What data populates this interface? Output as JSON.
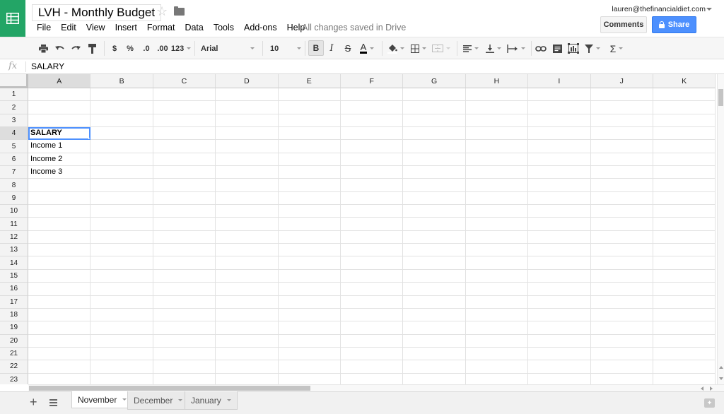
{
  "header": {
    "doc_title": "LVH - Monthly Budget",
    "menu": [
      "File",
      "Edit",
      "View",
      "Insert",
      "Format",
      "Data",
      "Tools",
      "Add-ons",
      "Help"
    ],
    "save_status": "All changes saved in Drive",
    "user_email": "lauren@thefinancialdiet.com",
    "comments_label": "Comments",
    "share_label": "Share",
    "brand_color": "#23a566",
    "share_color": "#4d90fe"
  },
  "toolbar": {
    "currency": "$",
    "percent": "%",
    "decrease_decimal": ".0",
    "increase_decimal": ".00",
    "number_format": "123",
    "font": "Arial",
    "font_size": "10",
    "bold": "B",
    "italic": "I",
    "strikethrough": "S",
    "text_color": "A",
    "functions": "Σ"
  },
  "formula_bar": {
    "fx_label": "fx",
    "value": "SALARY"
  },
  "grid": {
    "columns": [
      "A",
      "B",
      "C",
      "D",
      "E",
      "F",
      "G",
      "H",
      "I",
      "J",
      "K"
    ],
    "rows": [
      "1",
      "2",
      "3",
      "4",
      "5",
      "6",
      "7",
      "8",
      "9",
      "10",
      "11",
      "12",
      "13",
      "14",
      "15",
      "16",
      "17",
      "18",
      "19",
      "20",
      "21",
      "22",
      "23"
    ],
    "selected_cell": "A4",
    "cells": {
      "A4": "SALARY",
      "A5": "Income 1",
      "A6": "Income 2",
      "A7": "Income 3"
    }
  },
  "sheets": {
    "tabs": [
      "November",
      "December",
      "January"
    ],
    "active": "November"
  }
}
